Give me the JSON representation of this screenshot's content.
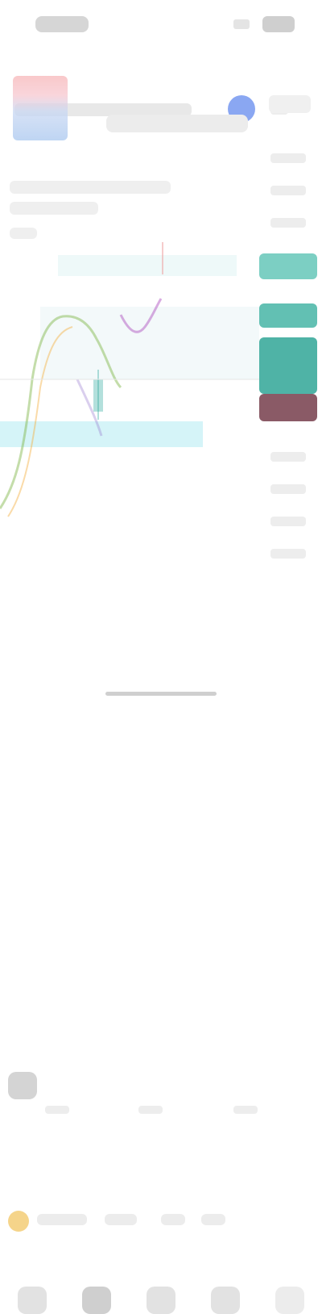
{
  "app": {
    "screen": "chart"
  },
  "colors": {
    "bullish": "#26a69a",
    "bearish": "#ef5350",
    "highlight_band": "#b2ebf2",
    "accent": "#5b7ff0",
    "ma_fast": "#f5b041",
    "ma_slow": "#7cb342",
    "ma_purple": "#ab47bc"
  },
  "icons": {
    "avatar": "user-avatar-icon",
    "menu": "menu-icon",
    "logo": "symbol-logo-icon",
    "drawing": "drawing-tools-icon",
    "info": "info-icon",
    "tabs": [
      "home-icon",
      "watchlist-icon",
      "chart-icon",
      "ideas-icon",
      "menu-icon"
    ]
  },
  "chart": {
    "visible_text_legible": false,
    "price_tags": [
      "bullish",
      "bullish",
      "bullish",
      "bearish"
    ]
  }
}
